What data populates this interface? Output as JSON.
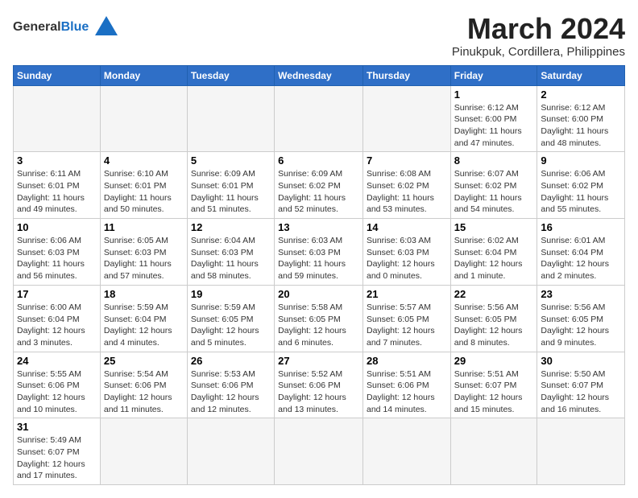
{
  "header": {
    "logo_general": "General",
    "logo_blue": "Blue",
    "title": "March 2024",
    "subtitle": "Pinukpuk, Cordillera, Philippines"
  },
  "weekdays": [
    "Sunday",
    "Monday",
    "Tuesday",
    "Wednesday",
    "Thursday",
    "Friday",
    "Saturday"
  ],
  "weeks": [
    [
      {
        "day": "",
        "info": ""
      },
      {
        "day": "",
        "info": ""
      },
      {
        "day": "",
        "info": ""
      },
      {
        "day": "",
        "info": ""
      },
      {
        "day": "",
        "info": ""
      },
      {
        "day": "1",
        "info": "Sunrise: 6:12 AM\nSunset: 6:00 PM\nDaylight: 11 hours and 47 minutes."
      },
      {
        "day": "2",
        "info": "Sunrise: 6:12 AM\nSunset: 6:00 PM\nDaylight: 11 hours and 48 minutes."
      }
    ],
    [
      {
        "day": "3",
        "info": "Sunrise: 6:11 AM\nSunset: 6:01 PM\nDaylight: 11 hours and 49 minutes."
      },
      {
        "day": "4",
        "info": "Sunrise: 6:10 AM\nSunset: 6:01 PM\nDaylight: 11 hours and 50 minutes."
      },
      {
        "day": "5",
        "info": "Sunrise: 6:09 AM\nSunset: 6:01 PM\nDaylight: 11 hours and 51 minutes."
      },
      {
        "day": "6",
        "info": "Sunrise: 6:09 AM\nSunset: 6:02 PM\nDaylight: 11 hours and 52 minutes."
      },
      {
        "day": "7",
        "info": "Sunrise: 6:08 AM\nSunset: 6:02 PM\nDaylight: 11 hours and 53 minutes."
      },
      {
        "day": "8",
        "info": "Sunrise: 6:07 AM\nSunset: 6:02 PM\nDaylight: 11 hours and 54 minutes."
      },
      {
        "day": "9",
        "info": "Sunrise: 6:06 AM\nSunset: 6:02 PM\nDaylight: 11 hours and 55 minutes."
      }
    ],
    [
      {
        "day": "10",
        "info": "Sunrise: 6:06 AM\nSunset: 6:03 PM\nDaylight: 11 hours and 56 minutes."
      },
      {
        "day": "11",
        "info": "Sunrise: 6:05 AM\nSunset: 6:03 PM\nDaylight: 11 hours and 57 minutes."
      },
      {
        "day": "12",
        "info": "Sunrise: 6:04 AM\nSunset: 6:03 PM\nDaylight: 11 hours and 58 minutes."
      },
      {
        "day": "13",
        "info": "Sunrise: 6:03 AM\nSunset: 6:03 PM\nDaylight: 11 hours and 59 minutes."
      },
      {
        "day": "14",
        "info": "Sunrise: 6:03 AM\nSunset: 6:03 PM\nDaylight: 12 hours and 0 minutes."
      },
      {
        "day": "15",
        "info": "Sunrise: 6:02 AM\nSunset: 6:04 PM\nDaylight: 12 hours and 1 minute."
      },
      {
        "day": "16",
        "info": "Sunrise: 6:01 AM\nSunset: 6:04 PM\nDaylight: 12 hours and 2 minutes."
      }
    ],
    [
      {
        "day": "17",
        "info": "Sunrise: 6:00 AM\nSunset: 6:04 PM\nDaylight: 12 hours and 3 minutes."
      },
      {
        "day": "18",
        "info": "Sunrise: 5:59 AM\nSunset: 6:04 PM\nDaylight: 12 hours and 4 minutes."
      },
      {
        "day": "19",
        "info": "Sunrise: 5:59 AM\nSunset: 6:05 PM\nDaylight: 12 hours and 5 minutes."
      },
      {
        "day": "20",
        "info": "Sunrise: 5:58 AM\nSunset: 6:05 PM\nDaylight: 12 hours and 6 minutes."
      },
      {
        "day": "21",
        "info": "Sunrise: 5:57 AM\nSunset: 6:05 PM\nDaylight: 12 hours and 7 minutes."
      },
      {
        "day": "22",
        "info": "Sunrise: 5:56 AM\nSunset: 6:05 PM\nDaylight: 12 hours and 8 minutes."
      },
      {
        "day": "23",
        "info": "Sunrise: 5:56 AM\nSunset: 6:05 PM\nDaylight: 12 hours and 9 minutes."
      }
    ],
    [
      {
        "day": "24",
        "info": "Sunrise: 5:55 AM\nSunset: 6:06 PM\nDaylight: 12 hours and 10 minutes."
      },
      {
        "day": "25",
        "info": "Sunrise: 5:54 AM\nSunset: 6:06 PM\nDaylight: 12 hours and 11 minutes."
      },
      {
        "day": "26",
        "info": "Sunrise: 5:53 AM\nSunset: 6:06 PM\nDaylight: 12 hours and 12 minutes."
      },
      {
        "day": "27",
        "info": "Sunrise: 5:52 AM\nSunset: 6:06 PM\nDaylight: 12 hours and 13 minutes."
      },
      {
        "day": "28",
        "info": "Sunrise: 5:51 AM\nSunset: 6:06 PM\nDaylight: 12 hours and 14 minutes."
      },
      {
        "day": "29",
        "info": "Sunrise: 5:51 AM\nSunset: 6:07 PM\nDaylight: 12 hours and 15 minutes."
      },
      {
        "day": "30",
        "info": "Sunrise: 5:50 AM\nSunset: 6:07 PM\nDaylight: 12 hours and 16 minutes."
      }
    ],
    [
      {
        "day": "31",
        "info": "Sunrise: 5:49 AM\nSunset: 6:07 PM\nDaylight: 12 hours and 17 minutes."
      },
      {
        "day": "",
        "info": ""
      },
      {
        "day": "",
        "info": ""
      },
      {
        "day": "",
        "info": ""
      },
      {
        "day": "",
        "info": ""
      },
      {
        "day": "",
        "info": ""
      },
      {
        "day": "",
        "info": ""
      }
    ]
  ]
}
